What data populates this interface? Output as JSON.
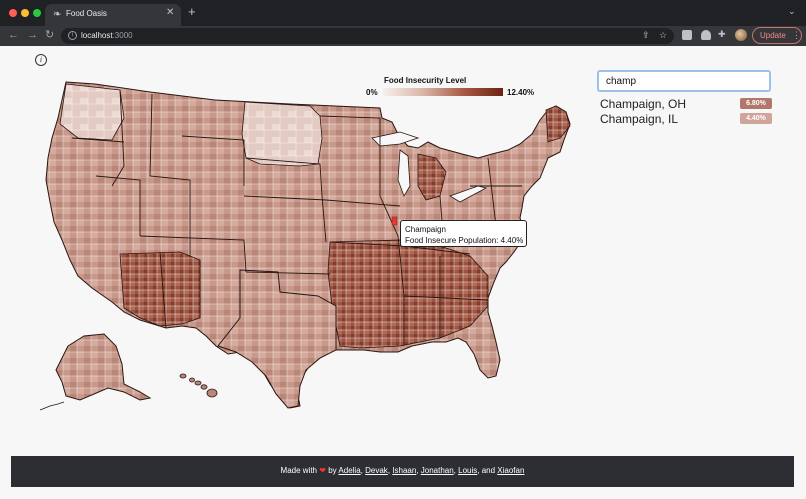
{
  "browser": {
    "tab_title": "Food Oasis",
    "url_host": "localhost",
    "url_port": ":3000",
    "update_label": "Update"
  },
  "icons": {
    "favicon": "leaf-icon",
    "close": "close-icon",
    "new_tab": "plus-icon",
    "info": "info-icon",
    "heart": "heart-icon"
  },
  "legend": {
    "title": "Food Insecurity Level",
    "min_label": "0%",
    "max_label": "12.40%",
    "colors": [
      "#f6efec",
      "#d9b6a8",
      "#a95b45",
      "#6b2314"
    ]
  },
  "search": {
    "value": "champ",
    "results": [
      {
        "name": "Champaign, OH",
        "value": "6.80%",
        "color": "#b2776b"
      },
      {
        "name": "Champaign, IL",
        "value": "4.40%",
        "color": "#cfa49a"
      }
    ]
  },
  "tooltip": {
    "county": "Champaign",
    "line": "Food Insecure Population: 4.40%",
    "highlight_color": "#e53935"
  },
  "footer": {
    "made_with": "Made with",
    "by": "by",
    "and": "and",
    "authors": [
      "Adelia",
      "Devak",
      "Ishaan",
      "Jonathan",
      "Louis",
      "Xiaofan"
    ]
  },
  "map_colors": {
    "fill": "#c49586",
    "outline": "#2a1510",
    "light": "#e8d8d2",
    "dark": "#7a3524"
  }
}
